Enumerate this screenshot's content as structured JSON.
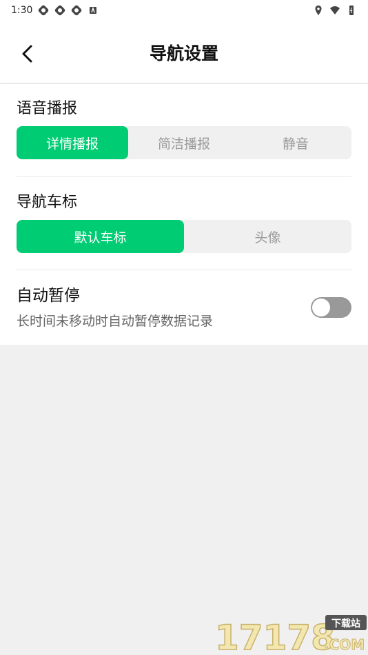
{
  "status_bar": {
    "time": "1:30",
    "icons": [
      "sync-icon",
      "sync-icon",
      "sync-icon",
      "a-icon",
      "location-icon",
      "wifi-icon",
      "battery-icon"
    ]
  },
  "header": {
    "back_icon": "back-arrow-icon",
    "title": "导航设置"
  },
  "voice": {
    "title": "语音播报",
    "options": [
      "详情播报",
      "简洁播报",
      "静音"
    ],
    "selected": 0
  },
  "car_marker": {
    "title": "导航车标",
    "options": [
      "默认车标",
      "头像"
    ],
    "selected": 0
  },
  "auto_pause": {
    "title": "自动暂停",
    "description": "长时间未移动时自动暂停数据记录",
    "enabled": false
  },
  "colors": {
    "accent": "#00cc73",
    "background": "#f0f0f0",
    "toggle_off": "#999999"
  },
  "watermark": {
    "text": "17178",
    "site": "下载站",
    "suffix": ".COM"
  }
}
